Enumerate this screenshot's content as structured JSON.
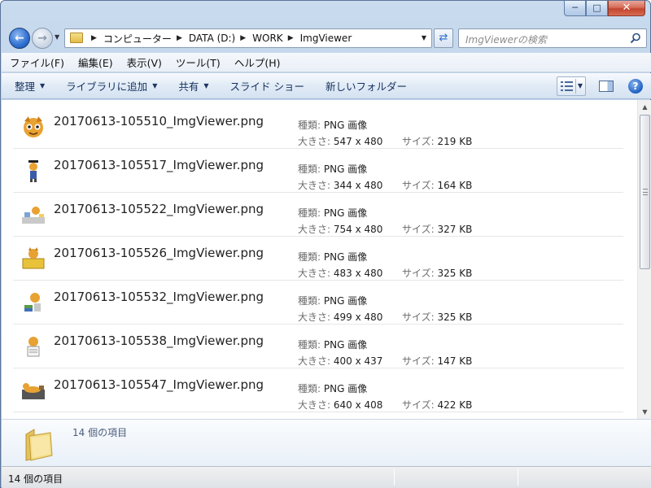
{
  "window": {
    "caption_buttons": {
      "minimize": "─",
      "maximize": "□",
      "close": "✕"
    }
  },
  "nav": {
    "back_glyph": "←",
    "forward_glyph": "→",
    "breadcrumbs": [
      "コンピューター",
      "DATA (D:)",
      "WORK",
      "ImgViewer"
    ],
    "search_placeholder": "ImgViewerの検索"
  },
  "menu": [
    "ファイル(F)",
    "編集(E)",
    "表示(V)",
    "ツール(T)",
    "ヘルプ(H)"
  ],
  "commands": [
    {
      "label": "整理",
      "dropdown": true
    },
    {
      "label": "ライブラリに追加",
      "dropdown": true
    },
    {
      "label": "共有",
      "dropdown": true
    },
    {
      "label": "スライド ショー",
      "dropdown": false
    },
    {
      "label": "新しいフォルダー",
      "dropdown": false
    }
  ],
  "help_glyph": "?",
  "labels": {
    "type": "種類:",
    "dims": "大きさ:",
    "size": "サイズ:"
  },
  "files": [
    {
      "name": "20170613-105510_ImgViewer.png",
      "type": "PNG 画像",
      "dims": "547 x 480",
      "size": "219 KB",
      "thumb": "cat-face-icon"
    },
    {
      "name": "20170613-105517_ImgViewer.png",
      "type": "PNG 画像",
      "dims": "344 x 480",
      "size": "164 KB",
      "thumb": "cat-graduate-icon"
    },
    {
      "name": "20170613-105522_ImgViewer.png",
      "type": "PNG 画像",
      "dims": "754 x 480",
      "size": "327 KB",
      "thumb": "cat-desk-icon"
    },
    {
      "name": "20170613-105526_ImgViewer.png",
      "type": "PNG 画像",
      "dims": "483 x 480",
      "size": "325 KB",
      "thumb": "cat-box-icon"
    },
    {
      "name": "20170613-105532_ImgViewer.png",
      "type": "PNG 画像",
      "dims": "499 x 480",
      "size": "325 KB",
      "thumb": "cat-books-icon"
    },
    {
      "name": "20170613-105538_ImgViewer.png",
      "type": "PNG 画像",
      "dims": "400 x 437",
      "size": "147 KB",
      "thumb": "cat-paper-icon"
    },
    {
      "name": "20170613-105547_ImgViewer.png",
      "type": "PNG 画像",
      "dims": "640 x 408",
      "size": "422 KB",
      "thumb": "cat-lying-icon"
    }
  ],
  "details_text": "14 個の項目",
  "status_text": "14 個の項目",
  "colors": {
    "accent": "#2e6fd1",
    "frame": "#b9cfe8"
  }
}
